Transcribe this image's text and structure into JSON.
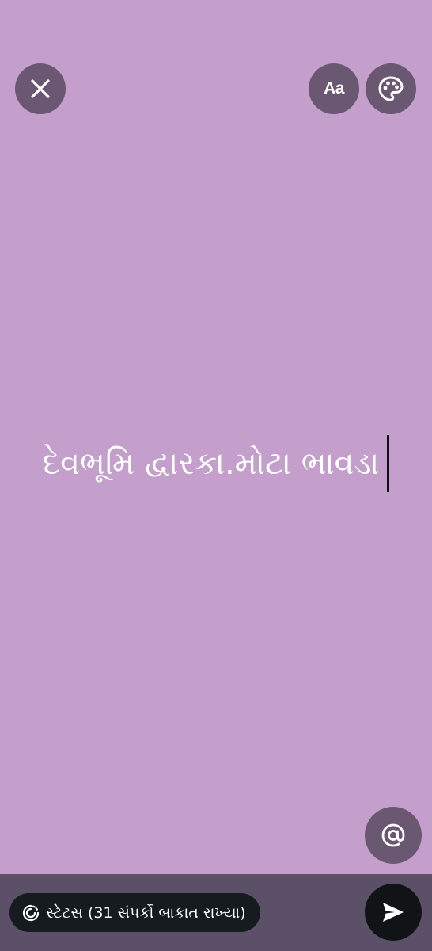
{
  "colors": {
    "background": "#c49fcb",
    "control_circle": "#6a5873",
    "bottom_bar": "#5b5068",
    "pill": "#151b1f",
    "send_button": "#111417",
    "text": "#ffffff",
    "cursor": "#111111"
  },
  "toolbar": {
    "close_icon": "close-icon",
    "font_label": "Aa",
    "palette_icon": "palette-icon"
  },
  "editor": {
    "text": "દેવભૂમિ દ્વારકા.મોટા ભાવડા"
  },
  "mention": {
    "icon": "at-sign-icon"
  },
  "footer": {
    "privacy_icon": "status-privacy-icon",
    "privacy_text": "સ્ટેટસ (31 સંપર્કો બાકાત રાખ્યા)",
    "send_icon": "send-icon"
  }
}
